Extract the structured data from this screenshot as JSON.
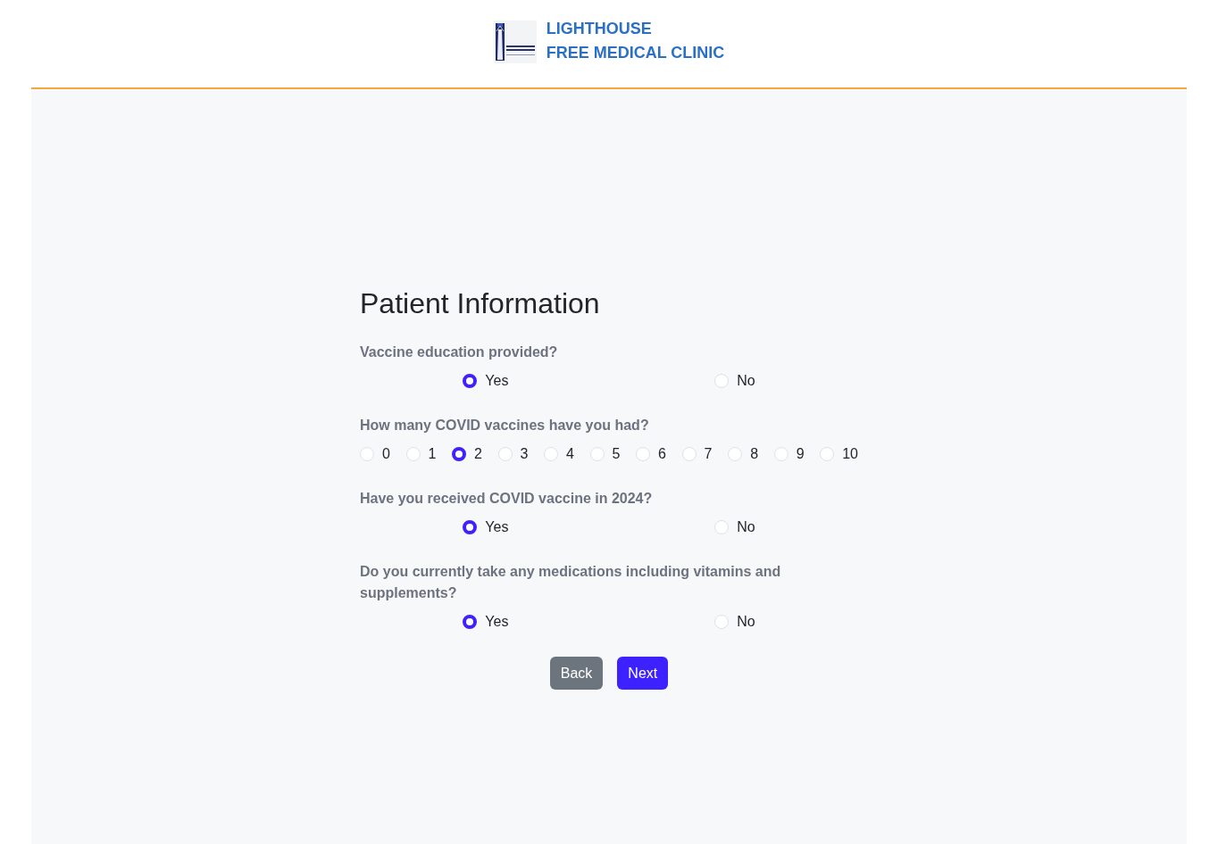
{
  "header": {
    "brand_lines": [
      "LIGHTHOUSE",
      "FREE MEDICAL CLINIC"
    ]
  },
  "form": {
    "title": "Patient Information",
    "questions": [
      {
        "kind": "yes_no",
        "label": "Vaccine education provided?",
        "options": [
          {
            "label": "Yes",
            "selected": true
          },
          {
            "label": "No",
            "selected": false
          }
        ]
      },
      {
        "kind": "scale",
        "label": "How many COVID vaccines have you had?",
        "options": [
          {
            "label": "0",
            "selected": false
          },
          {
            "label": "1",
            "selected": false
          },
          {
            "label": "2",
            "selected": true
          },
          {
            "label": "3",
            "selected": false
          },
          {
            "label": "4",
            "selected": false
          },
          {
            "label": "5",
            "selected": false
          },
          {
            "label": "6",
            "selected": false
          },
          {
            "label": "7",
            "selected": false
          },
          {
            "label": "8",
            "selected": false
          },
          {
            "label": "9",
            "selected": false
          },
          {
            "label": "10",
            "selected": false
          }
        ]
      },
      {
        "kind": "yes_no",
        "label": "Have you received COVID vaccine in 2024?",
        "options": [
          {
            "label": "Yes",
            "selected": true
          },
          {
            "label": "No",
            "selected": false
          }
        ]
      },
      {
        "kind": "yes_no",
        "label": "Do you currently take any medications including vitamins and supplements?",
        "options": [
          {
            "label": "Yes",
            "selected": true
          },
          {
            "label": "No",
            "selected": false
          }
        ]
      }
    ],
    "buttons": [
      {
        "label": "Back",
        "kind": "secondary"
      },
      {
        "label": "Next",
        "kind": "primary"
      }
    ]
  }
}
